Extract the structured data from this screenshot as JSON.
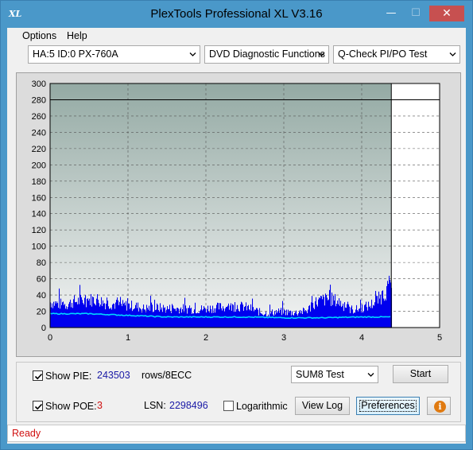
{
  "window": {
    "title": "PlexTools Professional XL V3.16",
    "app_icon": "XL",
    "minimize_glyph": "—",
    "maximize_glyph": "☐",
    "close_glyph": "✕"
  },
  "menu": [
    {
      "label": "Options"
    },
    {
      "label": "Help"
    }
  ],
  "toolbar": {
    "drive": "HA:5 ID:0  PX-760A",
    "function": "DVD Diagnostic Functions",
    "test": "Q-Check PI/PO Test"
  },
  "chart_data": {
    "type": "bar",
    "y_ticks": [
      "300",
      "280",
      "260",
      "240",
      "220",
      "200",
      "180",
      "160",
      "140",
      "120",
      "100",
      "80",
      "60",
      "40",
      "20",
      "0"
    ],
    "x_ticks": [
      "0",
      "1",
      "2",
      "3",
      "4",
      "5"
    ],
    "ylim": [
      0,
      300
    ],
    "xlim": [
      0,
      5
    ],
    "marker_line_y": 280,
    "end_x": 4.38,
    "grid": true,
    "colors": {
      "pie_bars": "#0000ee",
      "average_line": "#00d8ff",
      "background_top": "#94aaa4",
      "background_bottom": "#f2f3f3"
    },
    "series": [
      {
        "x": [
          0.0,
          0.1,
          0.2,
          0.3,
          0.4,
          0.5,
          0.6,
          0.7,
          0.8,
          0.9,
          1.0,
          1.1,
          1.2,
          1.3,
          1.4,
          1.5,
          1.6,
          1.7,
          1.8,
          1.9,
          2.0,
          2.1,
          2.2,
          2.3,
          2.4,
          2.5,
          2.6,
          2.7,
          2.8,
          2.9,
          3.0,
          3.1,
          3.2,
          3.3,
          3.4,
          3.5,
          3.6,
          3.7,
          3.8,
          3.9,
          4.0,
          4.1,
          4.2,
          4.3,
          4.38
        ],
        "values": [
          32,
          30,
          29,
          33,
          34,
          35,
          36,
          31,
          30,
          28,
          28,
          27,
          24,
          25,
          25,
          24,
          24,
          24,
          23,
          23,
          24,
          25,
          26,
          26,
          27,
          26,
          23,
          19,
          18,
          20,
          20,
          19,
          19,
          22,
          32,
          35,
          36,
          33,
          25,
          22,
          25,
          28,
          35,
          45,
          58
        ]
      },
      {
        "x": [
          0.0,
          0.5,
          1.0,
          1.5,
          2.0,
          2.5,
          3.0,
          3.5,
          4.0,
          4.38
        ],
        "values": [
          17,
          17,
          15,
          13,
          13,
          13,
          12,
          12,
          13,
          13
        ]
      }
    ]
  },
  "controls": {
    "show_pie_label": "Show PIE:",
    "pie_value": "243503",
    "pie_unit": "rows/8ECC",
    "show_poe_label": "Show POE:",
    "poe_value": "3",
    "lsn_label": "LSN:",
    "lsn_value": "2298496",
    "logarithmic_label": "Logarithmic",
    "show_pie_checked": true,
    "show_poe_checked": true,
    "logarithmic_checked": false,
    "test_select": "SUM8 Test",
    "start_label": "Start",
    "view_log_label": "View Log",
    "preferences_label": "Preferences",
    "info_glyph": "i"
  },
  "status": {
    "text": "Ready"
  }
}
